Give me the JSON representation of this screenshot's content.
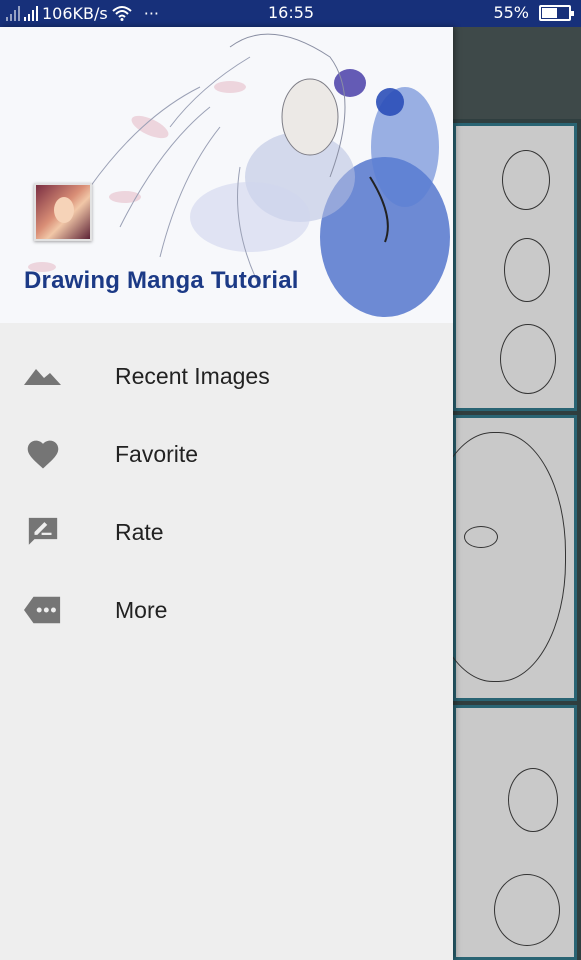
{
  "status_bar": {
    "network_speed": "106KB/s",
    "more": "···",
    "time": "16:55",
    "battery": "55%",
    "battery_level": 0.55
  },
  "drawer": {
    "app_title": "Drawing Manga Tutorial",
    "menu": [
      {
        "label": "Recent Images",
        "icon": "landscape-icon"
      },
      {
        "label": "Favorite",
        "icon": "heart-icon"
      },
      {
        "label": "Rate",
        "icon": "rate-review-icon"
      },
      {
        "label": "More",
        "icon": "more-label-icon"
      }
    ]
  },
  "colors": {
    "status_bar": "#17307a",
    "title": "#1c3a86",
    "icon": "#757575",
    "drawer_bg": "#eeeeee"
  }
}
